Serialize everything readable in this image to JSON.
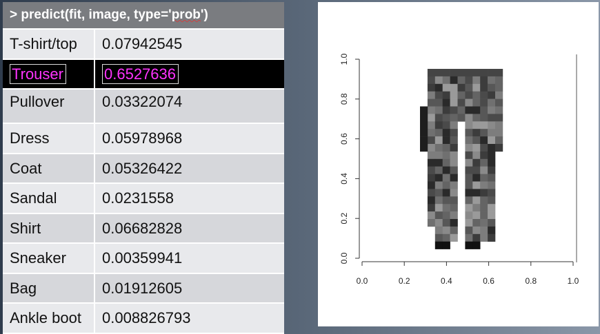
{
  "console": {
    "command_prefix": "> predict(fit,  image, type='",
    "command_squiggle": "prob",
    "command_suffix": "')"
  },
  "predictions": [
    {
      "label": "T-shirt/top",
      "value": "0.07942545"
    },
    {
      "label": "Trouser",
      "value": "0.6527636"
    },
    {
      "label": "Pullover",
      "value": "0.03322074"
    },
    {
      "label": "Dress",
      "value": "0.05978968"
    },
    {
      "label": "Coat",
      "value": "0.05326422"
    },
    {
      "label": "Sandal",
      "value": "0.0231558"
    },
    {
      "label": "Shirt",
      "value": "0.06682828"
    },
    {
      "label": "Sneaker",
      "value": "0.00359941"
    },
    {
      "label": "Bag",
      "value": "0.01912605"
    },
    {
      "label": "Ankle boot",
      "value": "0.008826793"
    }
  ],
  "highlight": {
    "color": "#ff33ff",
    "background": "#000000"
  },
  "plot": {
    "x_ticks": [
      "0.0",
      "0.2",
      "0.4",
      "0.6",
      "0.8",
      "1.0"
    ],
    "y_ticks": [
      "0.0",
      "0.2",
      "0.4",
      "0.6",
      "0.8",
      "1.0"
    ]
  }
}
